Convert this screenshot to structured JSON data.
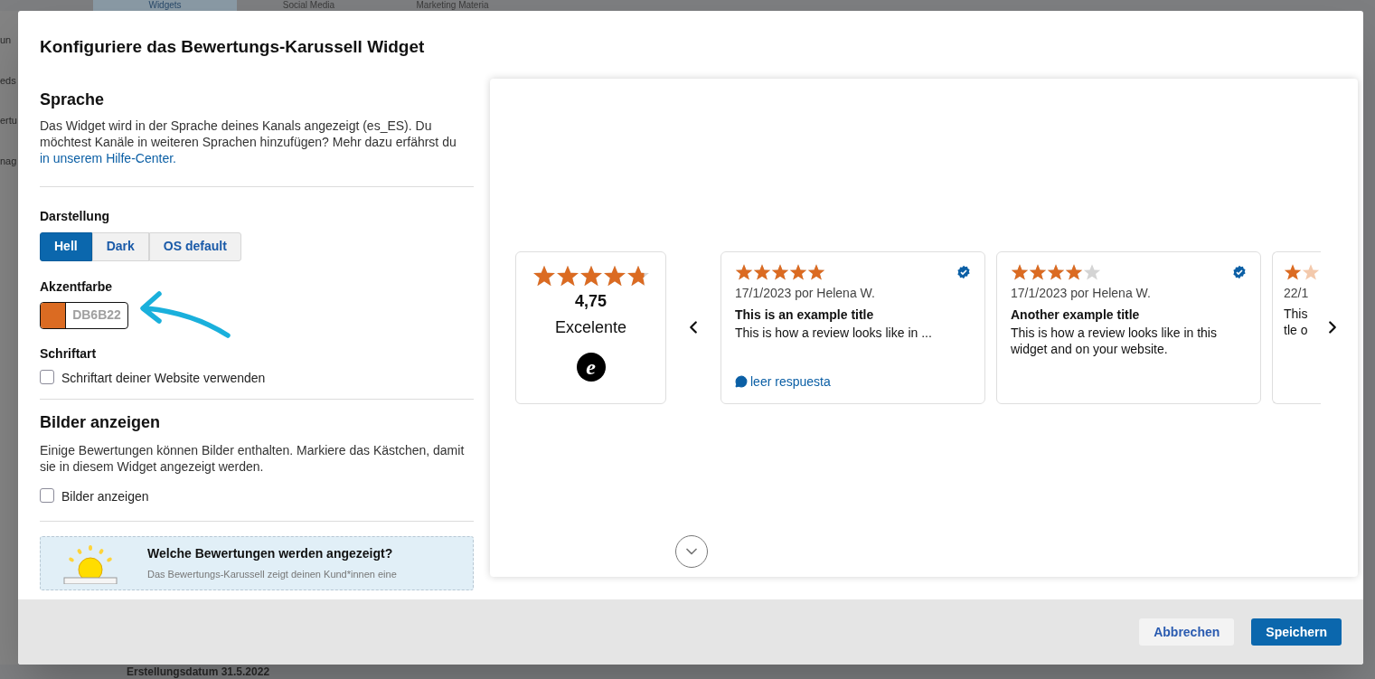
{
  "background": {
    "tabs": [
      {
        "label": "Widgets",
        "selected": true
      },
      {
        "label": "Social Media",
        "selected": false
      },
      {
        "label": "Marketing Materia",
        "selected": false
      }
    ],
    "side_fragments": [
      "un",
      "eds",
      "ertu",
      "nag"
    ],
    "footer_fragment": "Erstellungsdatum 31.5.2022"
  },
  "dialog": {
    "title": "Konfiguriere das Bewertungs-Karussell Widget",
    "language": {
      "heading": "Sprache",
      "text": "Das Widget wird in der Sprache deines Kanals angezeigt (es_ES). Du möchtest Kanäle in weiteren Sprachen hinzufügen? Mehr dazu erfährst du",
      "link": "in unserem Hilfe-Center."
    },
    "appearance": {
      "label": "Darstellung",
      "options": [
        {
          "label": "Hell",
          "selected": true
        },
        {
          "label": "Dark",
          "selected": false
        },
        {
          "label": "OS default",
          "selected": false
        }
      ]
    },
    "accent": {
      "label": "Akzentfarbe",
      "color": "#db6b22",
      "value": "DB6B22"
    },
    "font": {
      "label": "Schriftart",
      "checkbox": {
        "label": "Schriftart deiner Website verwenden",
        "checked": false
      }
    },
    "images": {
      "heading": "Bilder anzeigen",
      "text": "Einige Bewertungen können Bilder enthalten. Markiere das Kästchen, damit sie in diesem Widget angezeigt werden.",
      "checkbox": {
        "label": "Bilder anzeigen",
        "checked": false
      }
    },
    "info": {
      "title": "Welche Bewertungen werden angezeigt?",
      "text": "Das Bewertungs-Karussell zeigt deinen Kund*innen eine"
    },
    "preview": {
      "summary": {
        "stars": 4.75,
        "score": "4,75",
        "label": "Excelente",
        "logo_letter": "e"
      },
      "reviews": [
        {
          "stars": 5,
          "meta": "17/1/2023 por Helena W.",
          "title": "This is an example title",
          "text": "This is how a review looks like in ...",
          "verified": true,
          "reply_link": "leer respuesta"
        },
        {
          "stars": 4,
          "meta": "17/1/2023 por Helena W.",
          "title": "Another example title",
          "text": "This is how a review looks like in this widget and on your website.",
          "verified": true
        },
        {
          "meta": "22/1",
          "text": "This\ntle o",
          "kind": "partial"
        }
      ]
    },
    "buttons": [
      {
        "label": "Abbrechen",
        "kind": "secondary"
      },
      {
        "label": "Speichern",
        "kind": "primary"
      }
    ]
  }
}
